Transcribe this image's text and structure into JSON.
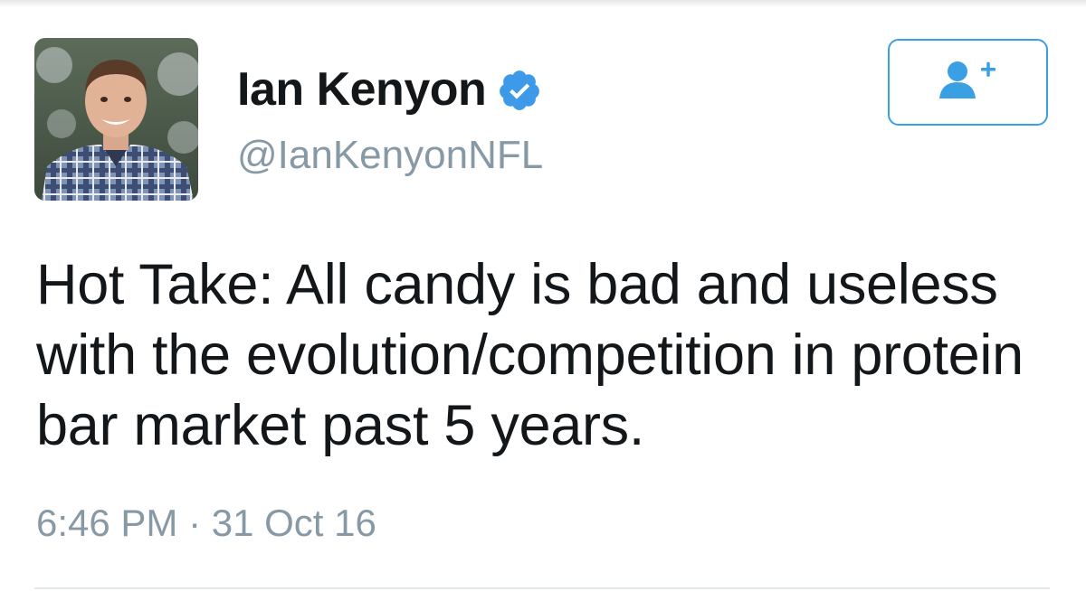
{
  "tweet": {
    "author": {
      "display_name": "Ian Kenyon",
      "handle": "@IanKenyonNFL",
      "verified": true,
      "avatar_icon": "profile-photo"
    },
    "text": "Hot Take: All candy is bad and useless with the evolution/competition in protein bar market past 5 years.",
    "timestamp": "6:46 PM · 31 Oct 16"
  },
  "follow_button": {
    "icon": "add-user-icon"
  },
  "colors": {
    "accent": "#3aa0e3",
    "verified": "#3d9ae8",
    "muted_text": "#8899a6",
    "primary_text": "#14171a"
  }
}
